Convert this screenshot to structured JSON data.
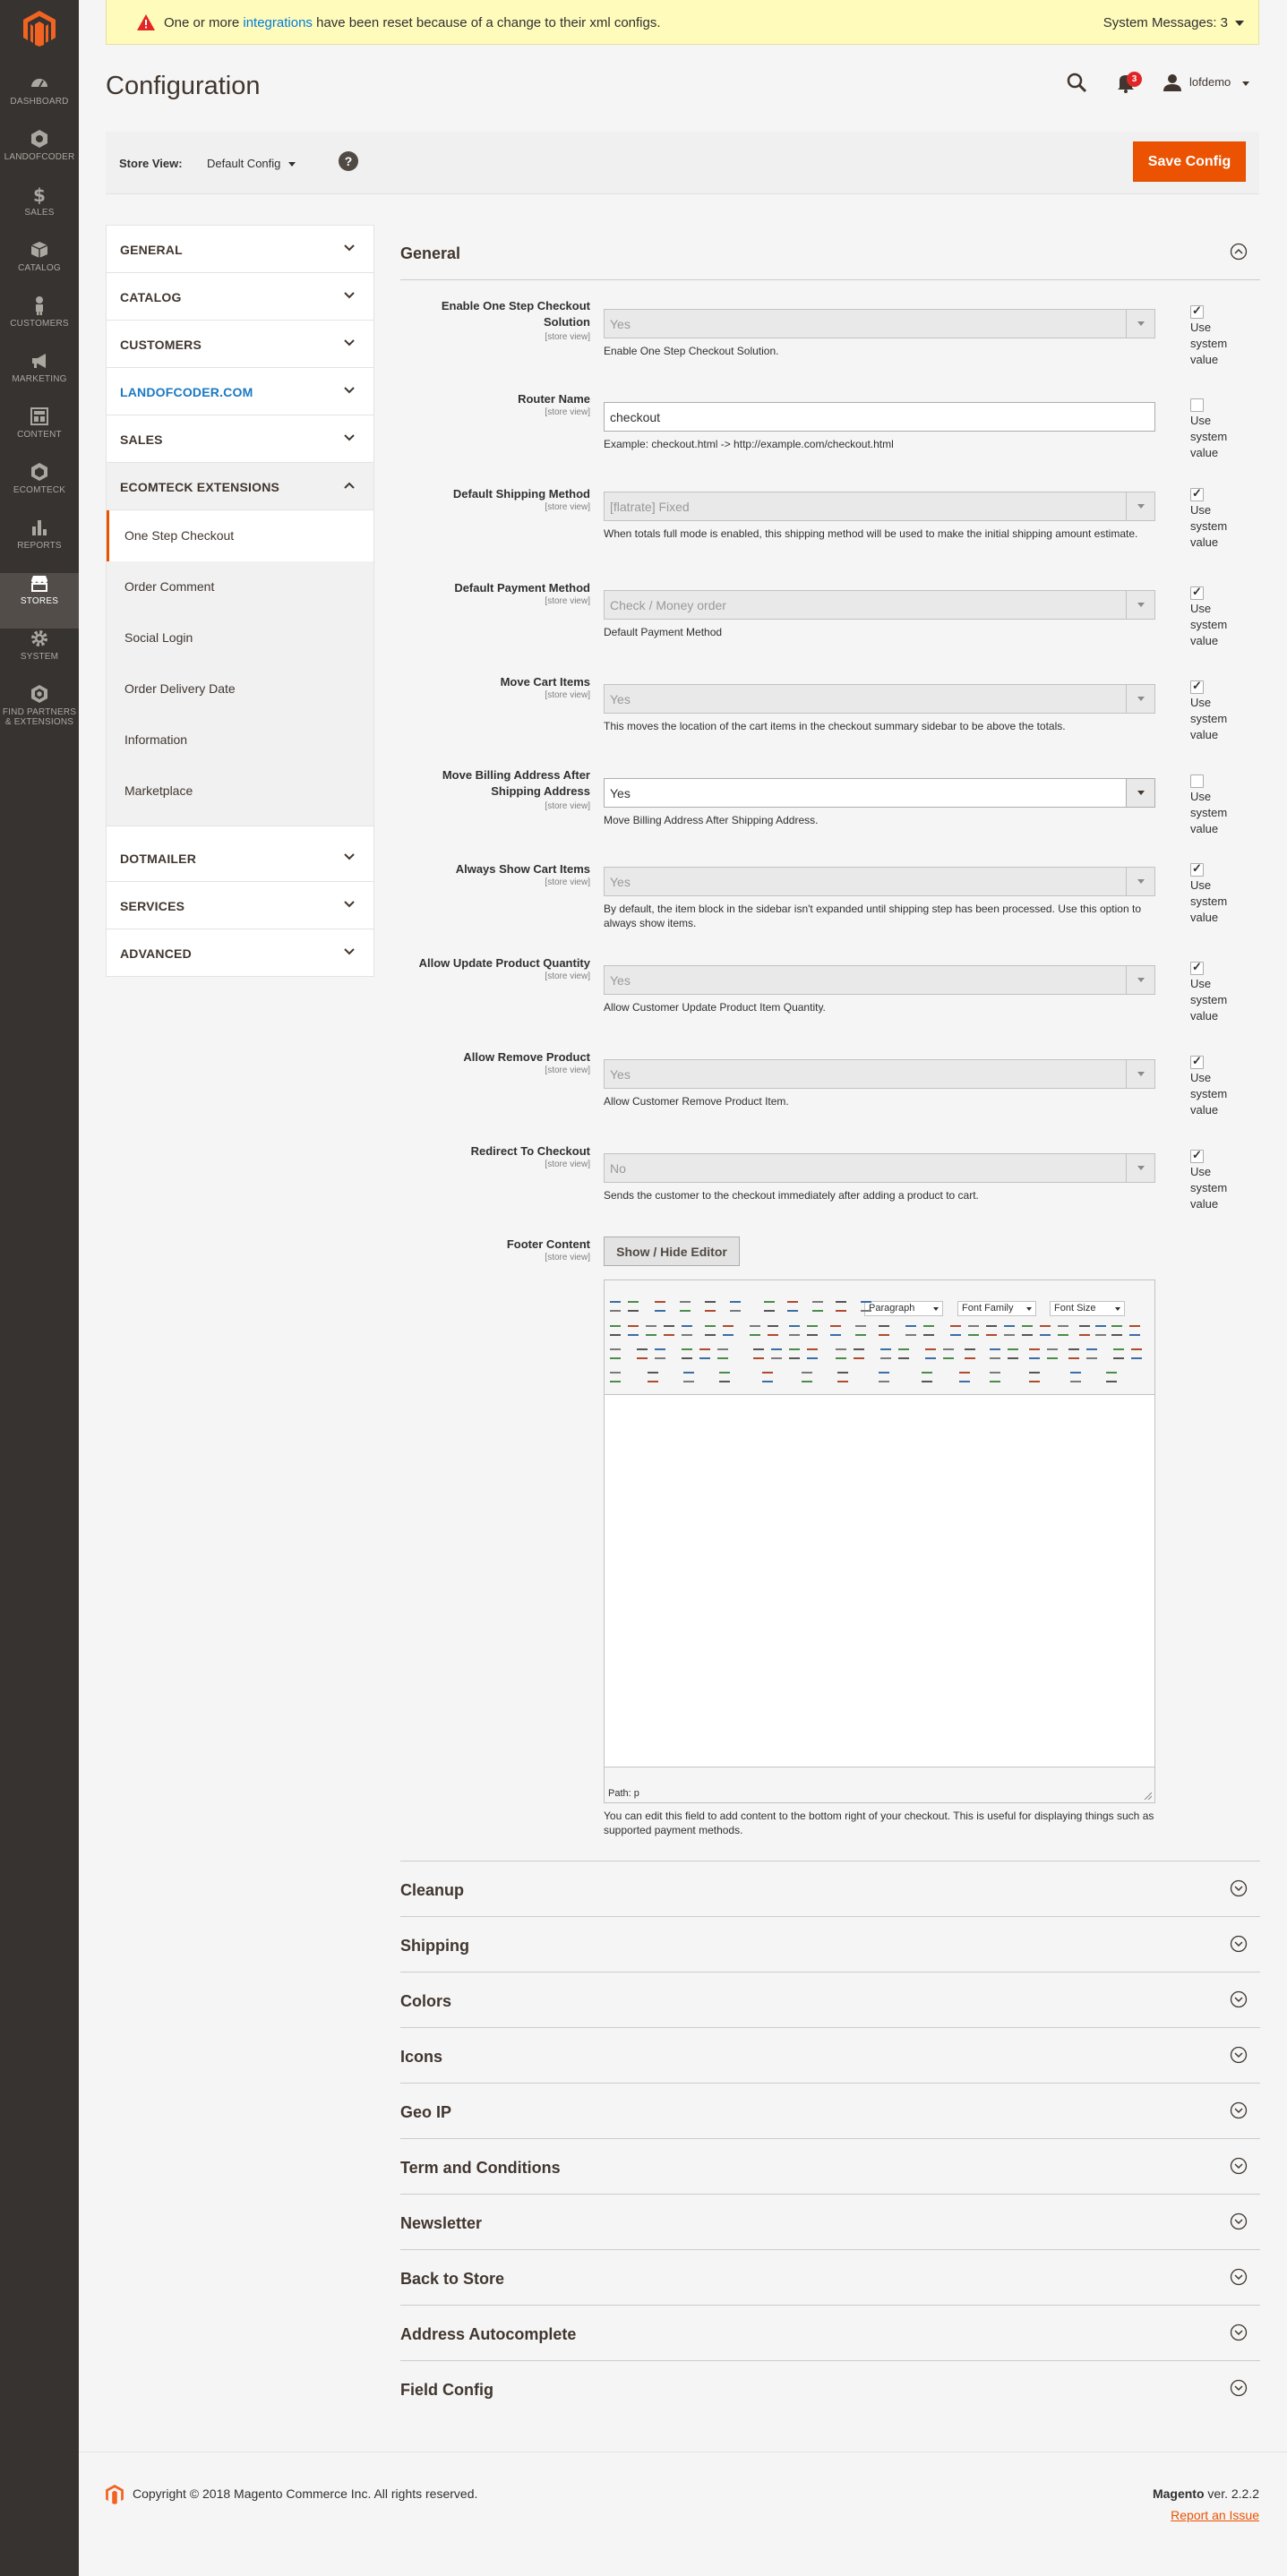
{
  "sidebar": {
    "items": [
      {
        "label": "DASHBOARD",
        "icon": "dashboard-icon"
      },
      {
        "label": "LANDOFCODER",
        "icon": "landofcoder-icon"
      },
      {
        "label": "SALES",
        "icon": "dollar-icon"
      },
      {
        "label": "CATALOG",
        "icon": "cube-icon"
      },
      {
        "label": "CUSTOMERS",
        "icon": "person-icon"
      },
      {
        "label": "MARKETING",
        "icon": "megaphone-icon"
      },
      {
        "label": "CONTENT",
        "icon": "layout-icon"
      },
      {
        "label": "ECOMTECK",
        "icon": "hexagon-icon"
      },
      {
        "label": "REPORTS",
        "icon": "bar-chart-icon"
      },
      {
        "label": "STORES",
        "icon": "store-icon"
      },
      {
        "label": "SYSTEM",
        "icon": "gear-icon"
      },
      {
        "label": "FIND PARTNERS",
        "label2": "& EXTENSIONS",
        "icon": "partners-icon"
      }
    ]
  },
  "notice": {
    "message_before": "One or more ",
    "message_link": "integrations",
    "message_after": " have been reset because of a change to their xml configs.",
    "system_messages": "System Messages: 3"
  },
  "header": {
    "title": "Configuration",
    "notification_count": "3",
    "username": "lofdemo"
  },
  "storebar": {
    "label": "Store View:",
    "value": "Default Config",
    "help": "?",
    "save_label": "Save Config"
  },
  "tabs": {
    "general": "GENERAL",
    "catalog": "CATALOG",
    "customers": "CUSTOMERS",
    "landofcoder": "LANDOFCODER.COM",
    "sales": "SALES",
    "ecomteck": "ECOMTECK EXTENSIONS",
    "ecomteck_items": [
      "One Step Checkout",
      "Order Comment",
      "Social Login",
      "Order Delivery Date",
      "Information",
      "Marketplace"
    ],
    "dotmailer": "DOTMAILER",
    "services": "SERVICES",
    "advanced": "ADVANCED"
  },
  "section": {
    "title": "General",
    "scope": "[store view]",
    "use_system": "Use system value",
    "fields": [
      {
        "label": "Enable One Step Checkout Solution",
        "value": "Yes",
        "note": "Enable One Step Checkout Solution."
      },
      {
        "label": "Router Name",
        "value": "checkout",
        "note": "Example: checkout.html -> http://example.com/checkout.html"
      },
      {
        "label": "Default Shipping Method",
        "value": "[flatrate] Fixed",
        "note": "When totals full mode is enabled, this shipping method will be used to make the initial shipping amount estimate."
      },
      {
        "label": "Default Payment Method",
        "value": "Check / Money order",
        "note": "Default Payment Method"
      },
      {
        "label": "Move Cart Items",
        "value": "Yes",
        "note": "This moves the location of the cart items in the checkout summary sidebar to be above the totals."
      },
      {
        "label": "Move Billing Address After Shipping Address",
        "value": "Yes",
        "note": "Move Billing Address After Shipping Address."
      },
      {
        "label": "Always Show Cart Items",
        "value": "Yes",
        "note": "By default, the item block in the sidebar isn't expanded until shipping step has been processed. Use this option to always show items."
      },
      {
        "label": "Allow Update Product Quantity",
        "value": "Yes",
        "note": "Allow Customer Update Product Item Quantity."
      },
      {
        "label": "Allow Remove Product",
        "value": "Yes",
        "note": "Allow Customer Remove Product Item."
      },
      {
        "label": "Redirect To Checkout",
        "value": "No",
        "note": "Sends the customer to the checkout immediately after adding a product to cart."
      }
    ],
    "footer_content": {
      "label": "Footer Content",
      "button": "Show / Hide Editor",
      "paragraph": "Paragraph",
      "font_family": "Font Family",
      "font_size": "Font Size",
      "path": "Path: p",
      "note": "You can edit this field to add content to the bottom right of your checkout. This is useful for displaying things such as supported payment methods."
    }
  },
  "collapsed_sections": [
    "Cleanup",
    "Shipping",
    "Colors",
    "Icons",
    "Geo IP",
    "Term and Conditions",
    "Newsletter",
    "Back to Store",
    "Address Autocomplete",
    "Field Config"
  ],
  "footer": {
    "copyright": "Copyright © 2018 Magento Commerce Inc. All rights reserved.",
    "brand": "Magento",
    "version": " ver. 2.2.2",
    "report": "Report an Issue"
  },
  "colors": {
    "accent": "#eb5202",
    "sidebar": "#373330",
    "link": "#1979c3"
  }
}
